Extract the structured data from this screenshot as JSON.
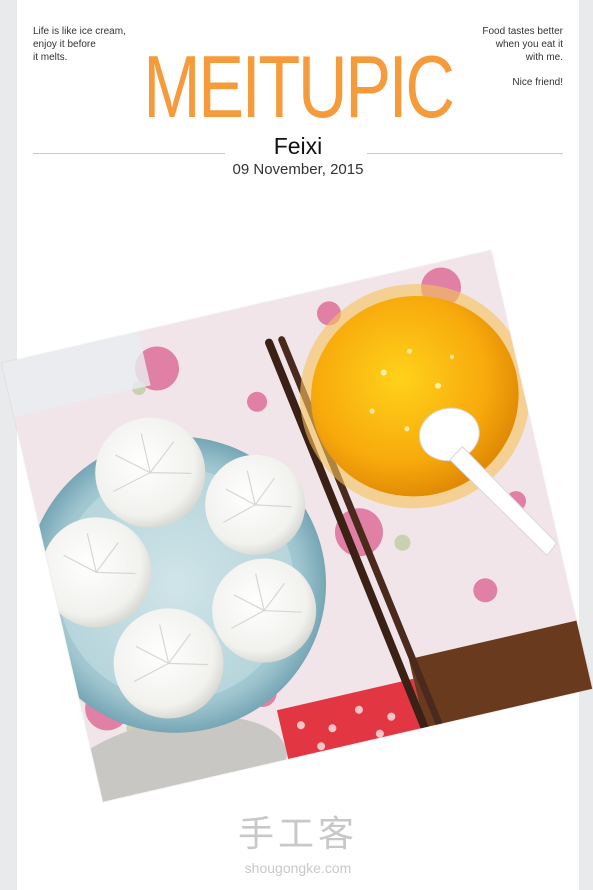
{
  "header": {
    "quote_left": [
      "Life is like ice cream,",
      "enjoy it before",
      "it melts."
    ],
    "quote_right": [
      "Food tastes better",
      "when you eat it",
      "with me."
    ],
    "quote_right_sub": "Nice friend!",
    "brand": "MEITUPIC",
    "name": "Feixi",
    "date": "09 November, 2015"
  },
  "photo": {
    "description_icon": "food-photo",
    "accent": "#f59b3c"
  },
  "watermark": {
    "chinese": "手工客",
    "url": "shougongke.com"
  }
}
